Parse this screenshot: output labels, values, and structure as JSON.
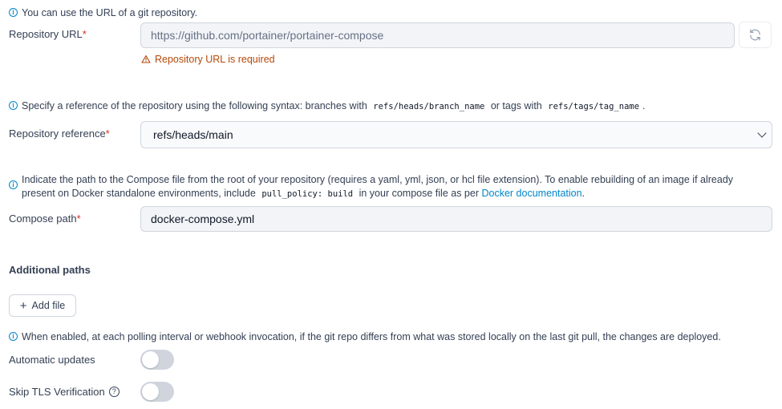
{
  "repo_url": {
    "hint": "You can use the URL of a git repository.",
    "label": "Repository URL",
    "required_mark": "*",
    "placeholder": "https://github.com/portainer/portainer-compose",
    "error": "Repository URL is required"
  },
  "repo_ref": {
    "hint_before": "Specify a reference of the repository using the following syntax: branches with",
    "hint_code1": "refs/heads/branch_name",
    "hint_middle": "or tags with",
    "hint_code2": "refs/tags/tag_name",
    "hint_after": ".",
    "label": "Repository reference",
    "required_mark": "*",
    "value": "refs/heads/main"
  },
  "compose_path": {
    "hint_line1": "Indicate the path to the Compose file from the root of your repository (requires a yaml, yml, json, or hcl file extension).  To enable rebuilding of an image if already",
    "hint_line2_before": "present on Docker standalone environments, include",
    "hint_code": "pull_policy: build",
    "hint_line2_after": "in your compose file as per",
    "hint_link": "Docker documentation",
    "hint_end": ".",
    "label": "Compose path",
    "required_mark": "*",
    "value": "docker-compose.yml"
  },
  "additional_paths": {
    "title": "Additional paths",
    "add_button": "Add file"
  },
  "auto_updates": {
    "hint": "When enabled, at each polling interval or webhook invocation, if the git repo differs from what was stored locally on the last git pull, the changes are deployed.",
    "label": "Automatic updates",
    "enabled": false
  },
  "skip_tls": {
    "label": "Skip TLS Verification",
    "enabled": false
  },
  "colors": {
    "accent": "#0086c9",
    "required": "#d92d20",
    "error": "#b54708",
    "toggle_off": "#d0d5dd"
  },
  "icons": {
    "info": "info-circle-icon",
    "warning": "alert-triangle-icon",
    "refresh": "refresh-icon",
    "plus": "plus-icon",
    "help": "question-circle-icon",
    "chevron": "chevron-down-icon"
  }
}
